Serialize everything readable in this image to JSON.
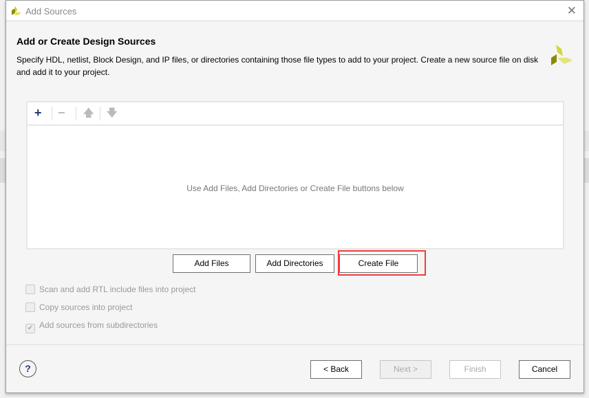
{
  "window": {
    "title": "Add Sources"
  },
  "page": {
    "heading": "Add or Create Design Sources",
    "description": "Specify HDL, netlist, Block Design, and IP files, or directories containing those file types to add to your project. Create a new source file on disk and add it to your project."
  },
  "file_panel": {
    "empty_message": "Use Add Files, Add Directories or Create File buttons below"
  },
  "buttons": {
    "add_files": "Add Files",
    "add_directories": "Add Directories",
    "create_file": "Create File",
    "back": "< Back",
    "next": "Next >",
    "finish": "Finish",
    "cancel": "Cancel",
    "help": "?"
  },
  "options": [
    {
      "label": "Scan and add RTL include files into project",
      "checked": false
    },
    {
      "label": "Copy sources into project",
      "checked": false
    },
    {
      "label": "Add sources from subdirectories",
      "checked": true
    }
  ],
  "colors": {
    "highlight": "#f03c3c",
    "logo_dark": "#8a8a00",
    "logo_light": "#d9e04a"
  }
}
